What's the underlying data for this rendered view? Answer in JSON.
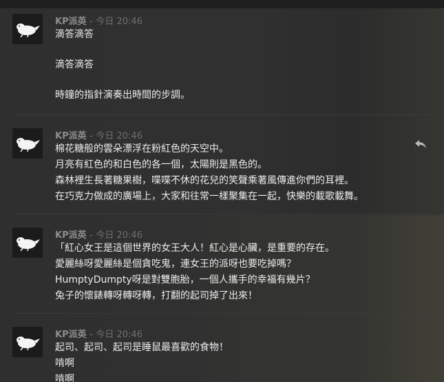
{
  "messages": [
    {
      "author": "KP派英",
      "separator": "-",
      "time": "今日 20:46",
      "avatar_icon": "white-bird-icon",
      "lines": [
        "滴答滴答",
        "滴答滴答",
        "時鐘的指針演奏出時間的步調。"
      ]
    },
    {
      "author": "KP派英",
      "separator": "-",
      "time": "今日 20:46",
      "avatar_icon": "white-bird-icon",
      "lines": [
        "棉花糖般的雲朵漂浮在粉紅色的天空中。",
        "月亮有紅色的和白色的各一個，太陽則是黑色的。",
        "森林裡生長著糖果樹，喋喋不休的花兒的笑聲乘著風傳進你們的耳裡。",
        "在巧克力做成的廣場上，大家和往常一樣聚集在一起，快樂的載歌載舞。"
      ]
    },
    {
      "author": "KP派英",
      "separator": "-",
      "time": "今日 20:46",
      "avatar_icon": "white-bird-icon",
      "lines": [
        "「紅心女王是這個世界的女王大人！紅心是心臟，是重要的存在。",
        "愛麗絲呀愛麗絲是個貪吃鬼，連女王的派呀也要吃掉嗎？",
        "HumptyDumpty呀是對雙胞胎，一個人攜手的幸福有幾片？",
        "兔子的懷錶轉呀轉呀轉，打翻的起司掉了出來！"
      ]
    },
    {
      "author": "KP派英",
      "separator": "-",
      "time": "今日 20:46",
      "avatar_icon": "white-bird-icon",
      "lines": [
        "起司、起司、起司是睡鼠最喜歡的食物！",
        "啃啊",
        "啃啊"
      ]
    }
  ],
  "actions": {
    "reply_icon": "reply-arrow-icon"
  },
  "colors": {
    "background": "#2f2f2f",
    "text": "#ececec",
    "author": "#8c8c8c",
    "timestamp": "#6f6f6f"
  }
}
